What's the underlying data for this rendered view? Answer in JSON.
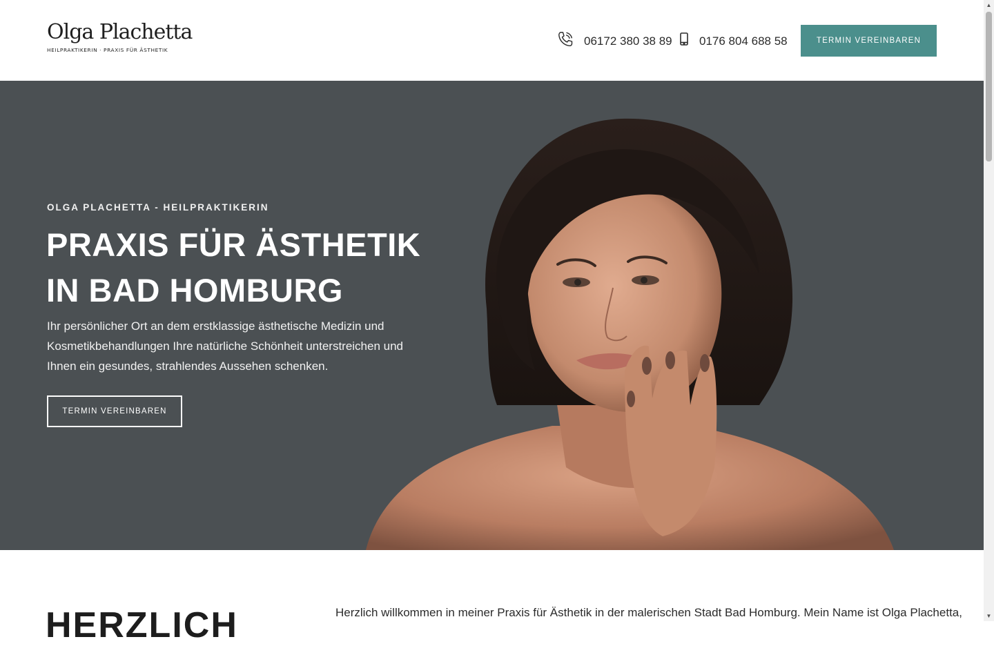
{
  "header": {
    "logo_name": "Olga Plachetta",
    "logo_sub": "HEILPRAKTIKERIN · PRAXIS FÜR ÄSTHETIK",
    "phone_landline": "06172 380 38 89",
    "phone_mobile": "0176 804 688 58",
    "cta_label": "TERMIN VEREINBAREN",
    "cta_color": "#4b8f8c",
    "icons": [
      "phone-icon",
      "mobile-phone-icon"
    ]
  },
  "hero": {
    "eyebrow": "OLGA PLACHETTA - HEILPRAKTIKERIN",
    "title_line1": "PRAXIS FÜR ÄSTHETIK",
    "title_line2": "IN BAD HOMBURG",
    "text": "Ihr persönlicher Ort an dem erstklassige ästhetische Medizin und Kosmetikbehandlungen Ihre natürliche Schönheit unterstreichen und Ihnen ein gesundes, strahlendes Aussehen schenken.",
    "cta_label": "TERMIN VEREINBAREN",
    "background_color": "#4b5053"
  },
  "intro": {
    "heading": "HERZLICH",
    "text": "Herzlich willkommen in meiner Praxis für Ästhetik in der malerischen Stadt Bad Homburg. Mein Name ist Olga Plachetta,"
  }
}
